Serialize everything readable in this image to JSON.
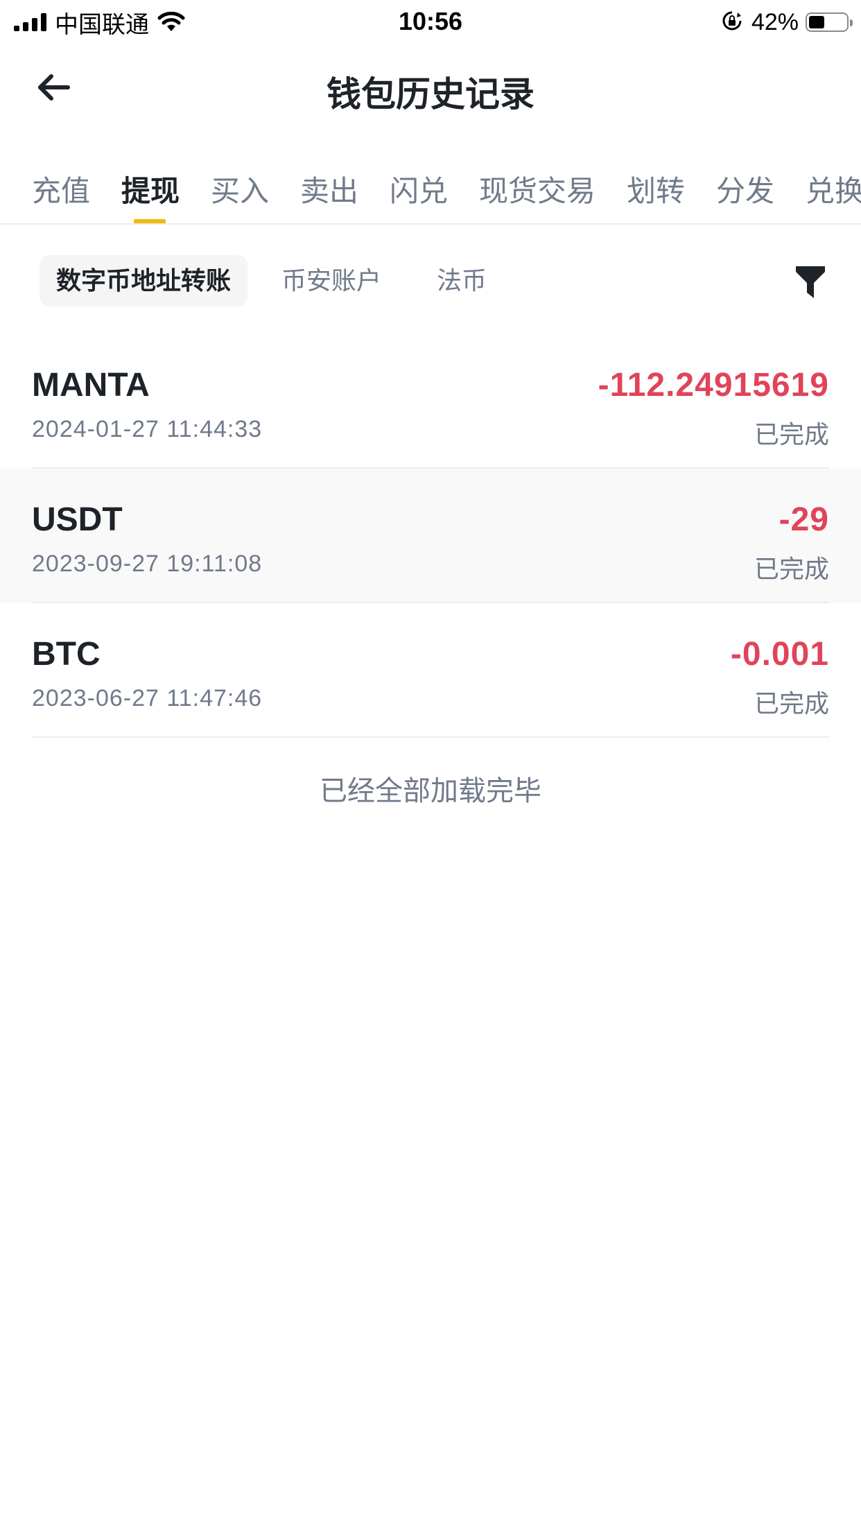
{
  "status_bar": {
    "carrier": "中国联通",
    "time": "10:56",
    "battery": "42%",
    "battery_level": 0.42
  },
  "header": {
    "back_icon": "arrow-left-icon",
    "title": "钱包历史记录"
  },
  "tabs": [
    {
      "label": "充值",
      "active": false
    },
    {
      "label": "提现",
      "active": true
    },
    {
      "label": "买入",
      "active": false
    },
    {
      "label": "卖出",
      "active": false
    },
    {
      "label": "闪兑",
      "active": false
    },
    {
      "label": "现货交易",
      "active": false
    },
    {
      "label": "划转",
      "active": false
    },
    {
      "label": "分发",
      "active": false
    },
    {
      "label": "兑换",
      "active": false
    }
  ],
  "subtabs": [
    {
      "label": "数字币地址转账",
      "active": true
    },
    {
      "label": "币安账户",
      "active": false
    },
    {
      "label": "法币",
      "active": false
    }
  ],
  "filter_icon": "filter-icon",
  "records": [
    {
      "coin": "MANTA",
      "time": "2024-01-27 11:44:33",
      "amount": "-112.24915619",
      "status": "已完成"
    },
    {
      "coin": "USDT",
      "time": "2023-09-27 19:11:08",
      "amount": "-29",
      "status": "已完成"
    },
    {
      "coin": "BTC",
      "time": "2023-06-27 11:47:46",
      "amount": "-0.001",
      "status": "已完成"
    }
  ],
  "end_text": "已经全部加载完毕",
  "colors": {
    "accent": "#f0b90b",
    "negative": "#e0445a",
    "text_primary": "#1e2329",
    "text_secondary": "#707a8a"
  }
}
